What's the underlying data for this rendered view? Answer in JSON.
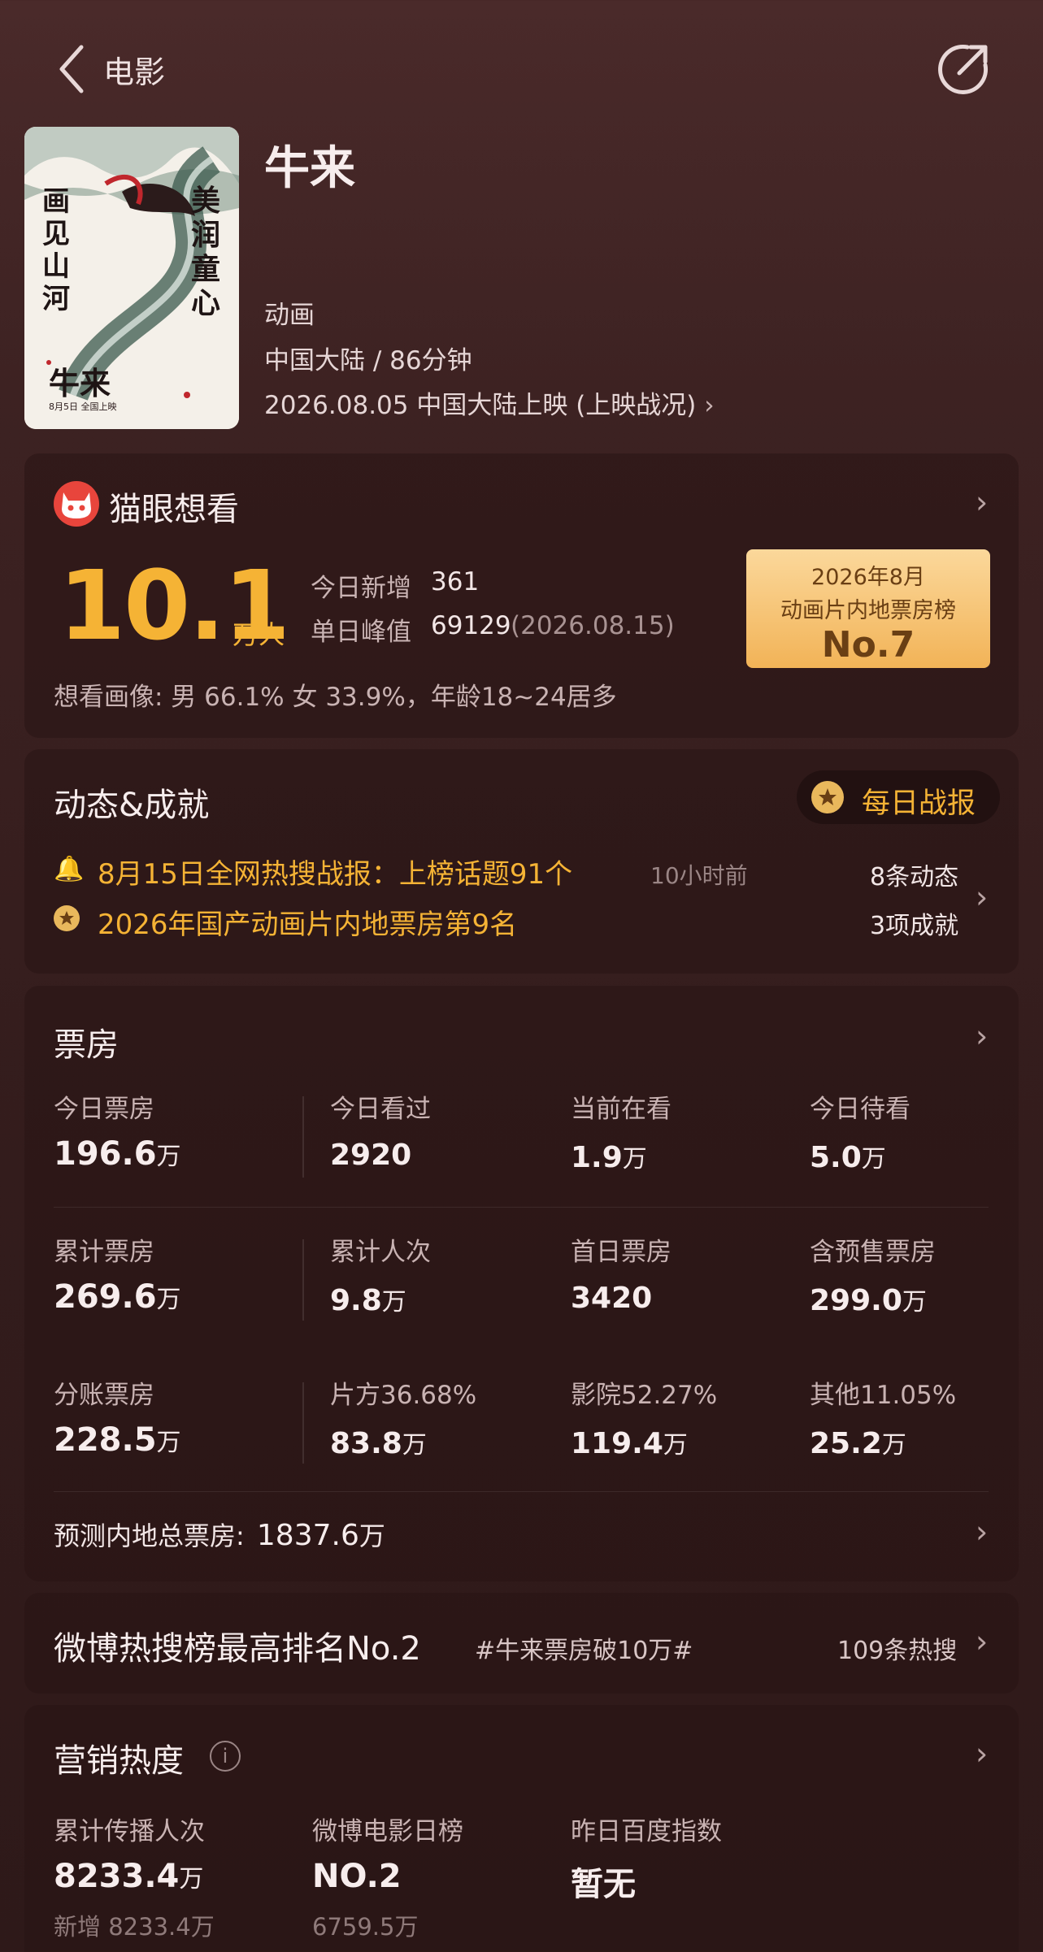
{
  "header": {
    "back_icon": "chevron-left-icon",
    "title": "电影",
    "share_icon": "share-icon"
  },
  "poster": {
    "left_text": "画见山河",
    "right_text": "美润童心",
    "title": "牛来",
    "date_line": "8月5日 全国上映"
  },
  "movie": {
    "title": "牛来",
    "genre": "动画",
    "region_duration": "中国大陆 / 86分钟",
    "release": "2026.08.05 中国大陆上映 (上映战况)"
  },
  "want": {
    "brand": "猫眼想看",
    "count": "10.1",
    "unit": "万人",
    "today_label": "今日新增",
    "today_value": "361",
    "peak_label": "单日峰值",
    "peak_value": "69129",
    "peak_date": "(2026.08.15)",
    "portrait": "想看画像: 男 66.1%  女 33.9%，年龄18~24居多",
    "badge_line1": "2026年8月",
    "badge_line2": "动画片内地票房榜",
    "badge_rank": "No.7",
    "colors": {
      "accent": "#f5b335"
    }
  },
  "dynamics": {
    "title": "动态&成就",
    "daily_report": "每日战报",
    "item1": "8月15日全网热搜战报：上榜话题91个",
    "item1_time": "10小时前",
    "item2": "2026年国产动画片内地票房第9名",
    "count1": "8条动态",
    "count2": "3项成就"
  },
  "boxoffice": {
    "title": "票房",
    "rows": [
      [
        {
          "label": "今日票房",
          "value": "196.6",
          "unit": "万"
        },
        {
          "label": "今日看过",
          "value": "2920",
          "unit": ""
        },
        {
          "label": "当前在看",
          "value": "1.9",
          "unit": "万"
        },
        {
          "label": "今日待看",
          "value": "5.0",
          "unit": "万"
        }
      ],
      [
        {
          "label": "累计票房",
          "value": "269.6",
          "unit": "万"
        },
        {
          "label": "累计人次",
          "value": "9.8",
          "unit": "万"
        },
        {
          "label": "首日票房",
          "value": "3420",
          "unit": ""
        },
        {
          "label": "含预售票房",
          "value": "299.0",
          "unit": "万"
        }
      ],
      [
        {
          "label": "分账票房",
          "value": "228.5",
          "unit": "万"
        },
        {
          "label": "片方36.68%",
          "value": "83.8",
          "unit": "万"
        },
        {
          "label": "影院52.27%",
          "value": "119.4",
          "unit": "万"
        },
        {
          "label": "其他11.05%",
          "value": "25.2",
          "unit": "万"
        }
      ]
    ],
    "forecast_label": "预测内地总票房:",
    "forecast_value": "1837.6",
    "forecast_unit": "万"
  },
  "weibo": {
    "title": "微博热搜榜最高排名No.2",
    "tag": "#牛来票房破10万#",
    "count": "109条热搜"
  },
  "marketing": {
    "title": "营销热度",
    "cols": [
      {
        "label": "累计传播人次",
        "value": "8233.4",
        "unit": "万",
        "sub": "新增 8233.4万"
      },
      {
        "label": "微博电影日榜",
        "value": "NO.2",
        "unit": "",
        "sub": "6759.5万"
      },
      {
        "label": "昨日百度指数",
        "value": "暂无",
        "unit": "",
        "sub": ""
      }
    ]
  }
}
